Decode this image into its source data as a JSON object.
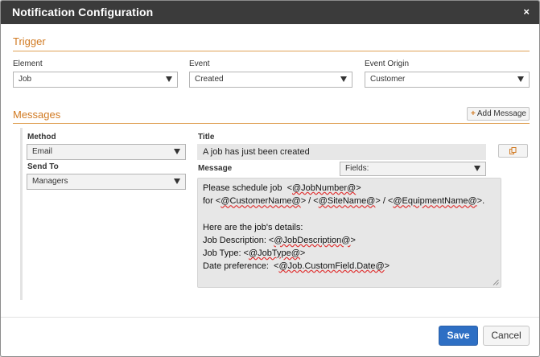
{
  "dialog": {
    "title": "Notification Configuration",
    "close_glyph": "×"
  },
  "trigger": {
    "heading": "Trigger",
    "element": {
      "label": "Element",
      "value": "Job"
    },
    "event": {
      "label": "Event",
      "value": "Created"
    },
    "event_origin": {
      "label": "Event Origin",
      "value": "Customer"
    }
  },
  "messages": {
    "heading": "Messages",
    "add_label": "Add Message",
    "add_glyph": "+",
    "item": {
      "method": {
        "label": "Method",
        "value": "Email"
      },
      "send_to": {
        "label": "Send To",
        "value": "Managers"
      },
      "title": {
        "label": "Title",
        "value": "A job has just been created"
      },
      "message": {
        "label": "Message",
        "fields_value": "Fields:",
        "lines": [
          [
            "Please schedule job  <",
            "@JobNumber@",
            ">"
          ],
          [
            "for <",
            "@CustomerName@",
            "> / <",
            "@SiteName@",
            "> / <",
            "@EquipmentName@",
            ">."
          ],
          [
            ""
          ],
          [
            "Here are the job's details:"
          ],
          [
            "Job Description: <",
            "@JobDescription@",
            ">"
          ],
          [
            "Job Type: <",
            "@JobType@",
            ">"
          ],
          [
            "Date preference:  <",
            "@Job.CustomField.Date@",
            ">"
          ]
        ]
      }
    }
  },
  "footer": {
    "save_label": "Save",
    "cancel_label": "Cancel"
  },
  "colors": {
    "header_bg": "#3b3b3b",
    "section_accent": "#d17a22",
    "primary_button": "#2e6fc4"
  },
  "icons": {
    "close": "close-icon",
    "add": "plus-icon",
    "copy": "copy-icon",
    "dropdown": "caret-down-icon",
    "resize": "resize-grip-icon"
  }
}
